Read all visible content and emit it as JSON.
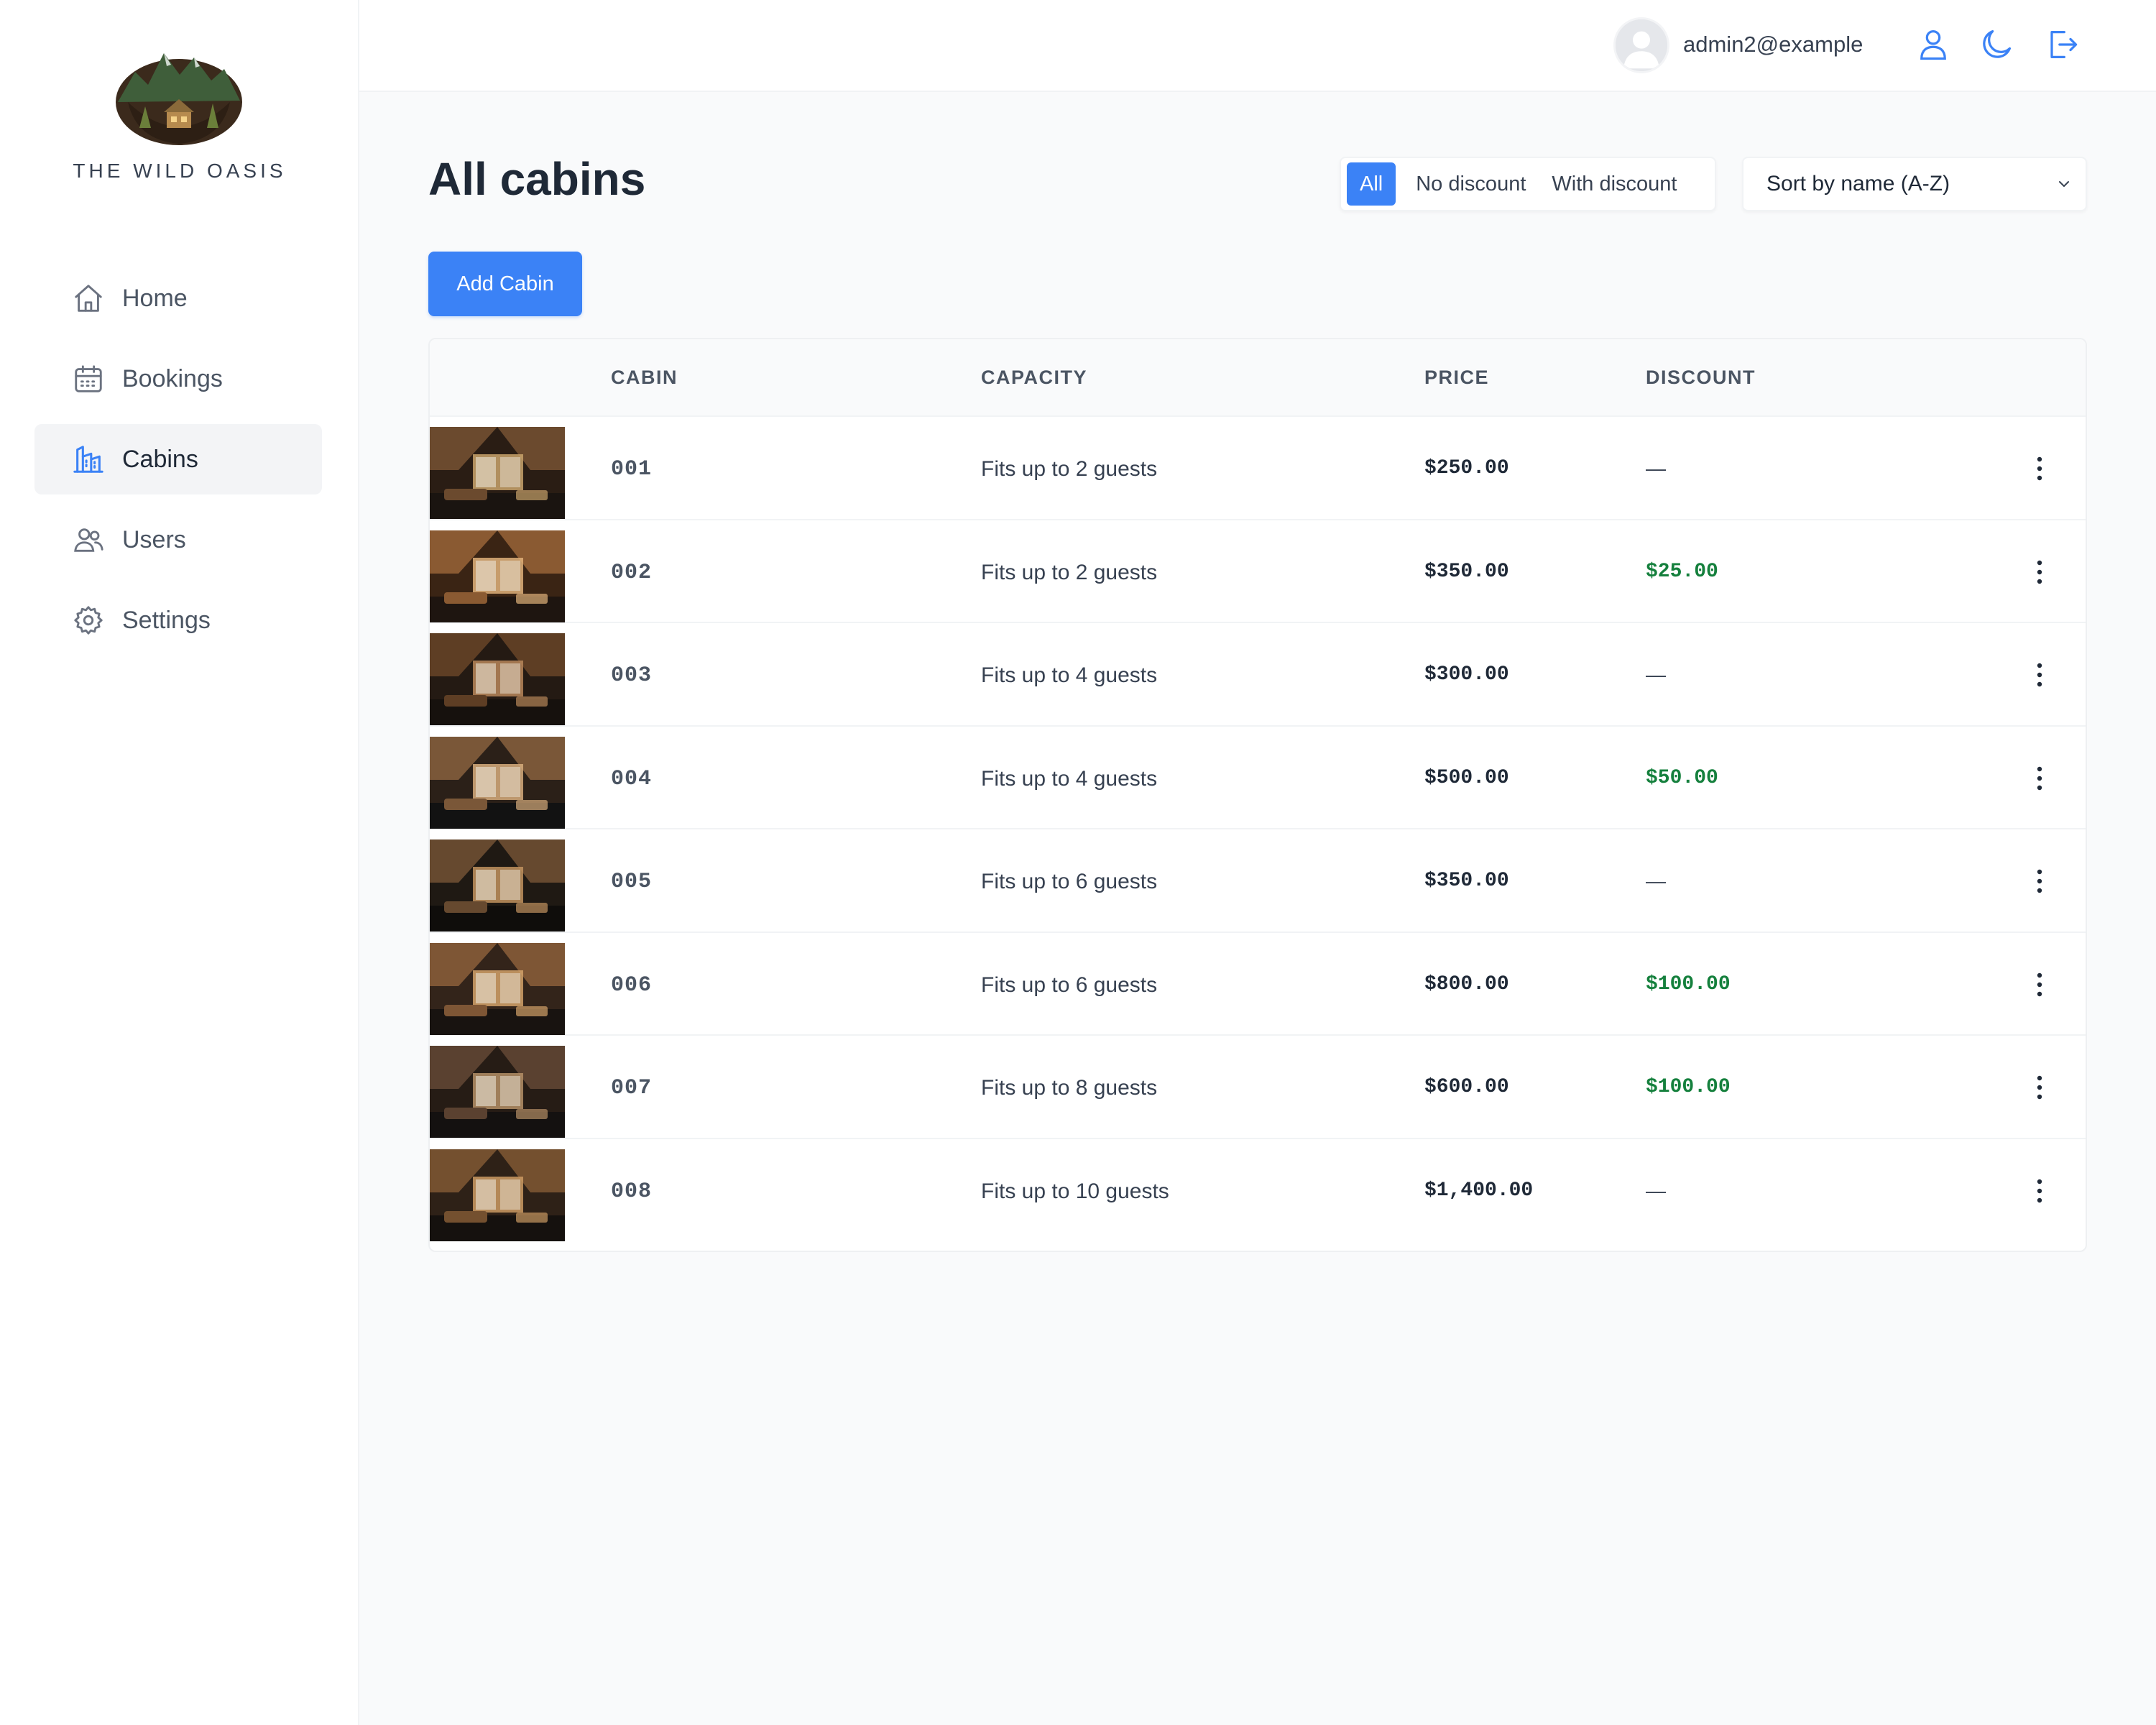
{
  "brand": {
    "name": "THE WILD OASIS"
  },
  "nav": [
    {
      "label": "Home",
      "icon": "home-icon"
    },
    {
      "label": "Bookings",
      "icon": "calendar-icon"
    },
    {
      "label": "Cabins",
      "icon": "building-icon",
      "active": true
    },
    {
      "label": "Users",
      "icon": "users-icon"
    },
    {
      "label": "Settings",
      "icon": "gear-icon"
    }
  ],
  "header": {
    "user_name": "admin2@example",
    "icons": [
      "user-icon",
      "moon-icon",
      "logout-icon"
    ]
  },
  "page": {
    "title": "All cabins",
    "add_button": "Add Cabin"
  },
  "filter": {
    "options": [
      "All",
      "No discount",
      "With discount"
    ],
    "active": "All"
  },
  "sort": {
    "selected": "Sort by name (A-Z)"
  },
  "table": {
    "headers": [
      "CABIN",
      "CAPACITY",
      "PRICE",
      "DISCOUNT"
    ],
    "rows": [
      {
        "name": "001",
        "capacity": "Fits up to 2 guests",
        "price": "$250.00",
        "discount": "—"
      },
      {
        "name": "002",
        "capacity": "Fits up to 2 guests",
        "price": "$350.00",
        "discount": "$25.00"
      },
      {
        "name": "003",
        "capacity": "Fits up to 4 guests",
        "price": "$300.00",
        "discount": "—"
      },
      {
        "name": "004",
        "capacity": "Fits up to 4 guests",
        "price": "$500.00",
        "discount": "$50.00"
      },
      {
        "name": "005",
        "capacity": "Fits up to 6 guests",
        "price": "$350.00",
        "discount": "—"
      },
      {
        "name": "006",
        "capacity": "Fits up to 6 guests",
        "price": "$800.00",
        "discount": "$100.00"
      },
      {
        "name": "007",
        "capacity": "Fits up to 8 guests",
        "price": "$600.00",
        "discount": "$100.00"
      },
      {
        "name": "008",
        "capacity": "Fits up to 10 guests",
        "price": "$1,400.00",
        "discount": "—"
      }
    ]
  },
  "colors": {
    "accent": "#3b82f6",
    "discount": "#15803d"
  }
}
